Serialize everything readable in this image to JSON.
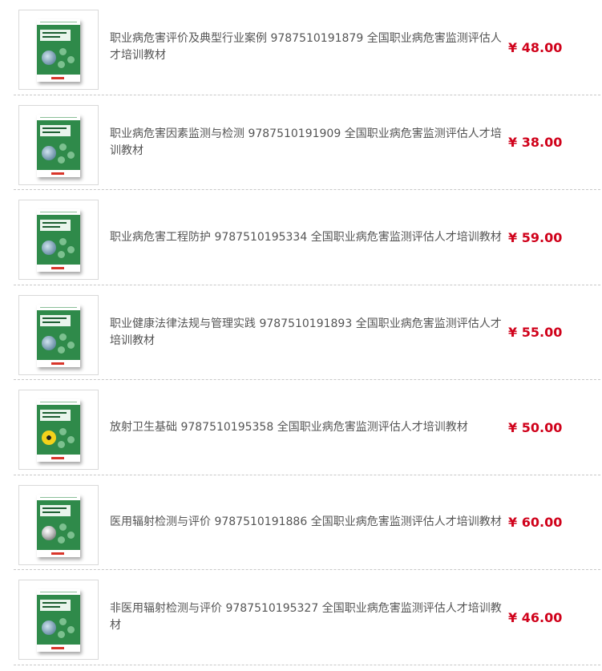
{
  "currency_symbol": "¥",
  "accent_color": "#d0021b",
  "products": [
    {
      "title": "职业病危害评价及典型行业案例 9787510191879 全国职业病危害监测评估人才培训教材",
      "price": "48.00",
      "cover_icon": "book-cover-photo"
    },
    {
      "title": "职业病危害因素监测与检测 9787510191909 全国职业病危害监测评估人才培训教材",
      "price": "38.00",
      "cover_icon": "book-cover-photo"
    },
    {
      "title": "职业病危害工程防护 9787510195334 全国职业病危害监测评估人才培训教材",
      "price": "59.00",
      "cover_icon": "book-cover-photo"
    },
    {
      "title": "职业健康法律法规与管理实践 9787510191893 全国职业病危害监测评估人才培训教材",
      "price": "55.00",
      "cover_icon": "book-cover-photo"
    },
    {
      "title": "放射卫生基础 9787510195358 全国职业病危害监测评估人才培训教材",
      "price": "50.00",
      "cover_icon": "book-cover-radiation"
    },
    {
      "title": "医用辐射检测与评价 9787510191886 全国职业病危害监测评估人才培训教材",
      "price": "60.00",
      "cover_icon": "book-cover-sphere"
    },
    {
      "title": "非医用辐射检测与评价 9787510195327 全国职业病危害监测评估人才培训教材",
      "price": "46.00",
      "cover_icon": "book-cover-photo"
    }
  ]
}
